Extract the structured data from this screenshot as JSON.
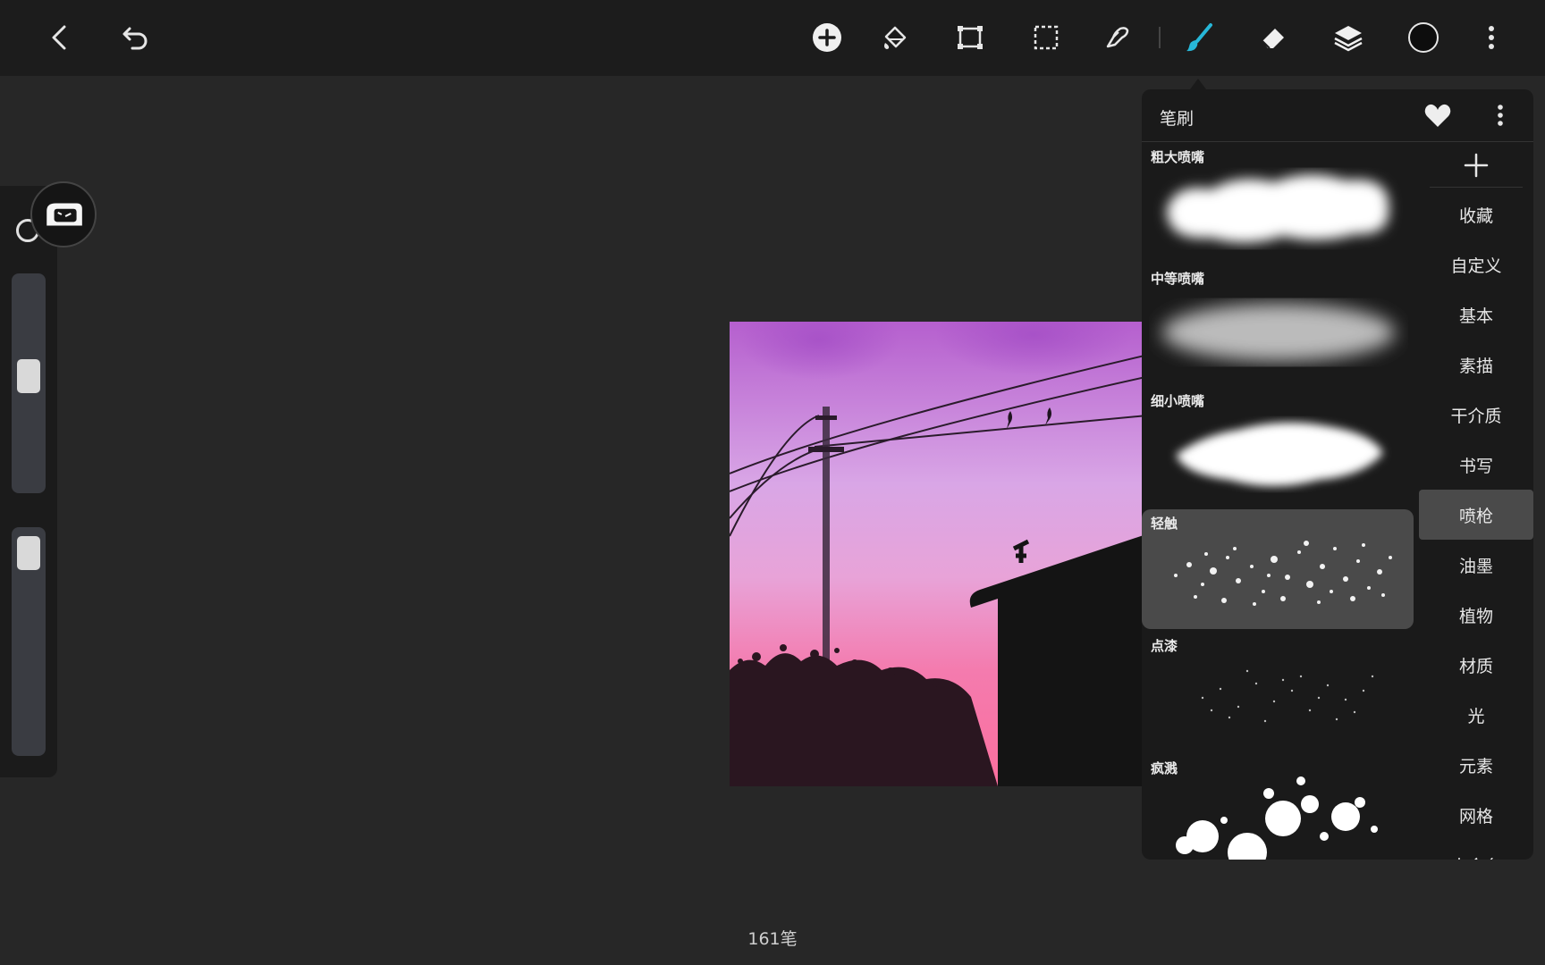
{
  "toolbar": {
    "back_icon": "chevron-left-icon",
    "undo_icon": "undo-icon",
    "tools": [
      "add-icon",
      "fill-bucket-icon",
      "transform-icon",
      "selection-icon",
      "smudge-icon",
      "brush-icon",
      "eraser-icon",
      "layers-icon",
      "color-icon",
      "more-icon"
    ],
    "active_tool": "brush-icon",
    "accent_color": "#27b7d8"
  },
  "brush_panel": {
    "title": "笔刷",
    "brushes": [
      {
        "name": "粗大喷嘴",
        "selected": false
      },
      {
        "name": "中等喷嘴",
        "selected": false
      },
      {
        "name": "细小喷嘴",
        "selected": false
      },
      {
        "name": "轻触",
        "selected": true
      },
      {
        "name": "点漆",
        "selected": false
      },
      {
        "name": "疯溅",
        "selected": false
      }
    ],
    "categories": [
      "收藏",
      "自定义",
      "基本",
      "素描",
      "干介质",
      "书写",
      "喷枪",
      "油墨",
      "植物",
      "材质",
      "光",
      "元素",
      "网格",
      "未命名"
    ],
    "active_category": "喷枪"
  },
  "status": {
    "stroke_count": "161笔"
  }
}
